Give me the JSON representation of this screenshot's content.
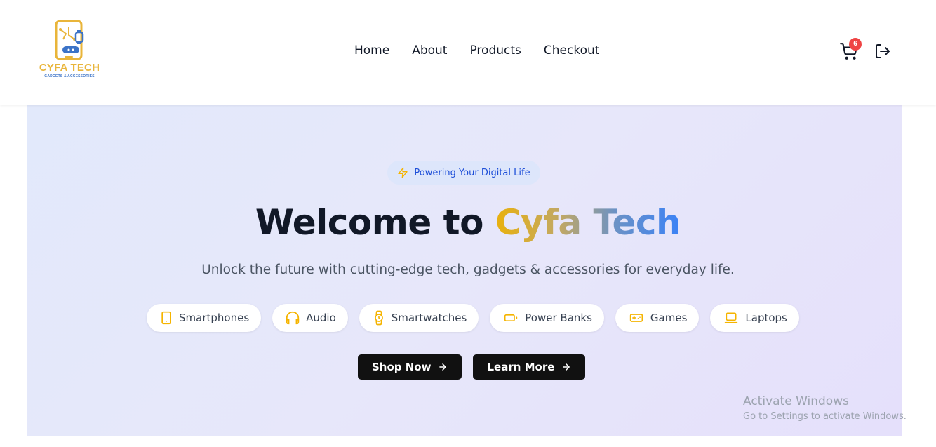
{
  "brand": {
    "name": "CYFA TECH",
    "tagline": "GADGETS & ACCESSORIES",
    "primary_color": "#e9b53a",
    "secondary_color": "#3b73c7"
  },
  "nav": {
    "items": [
      {
        "label": "Home"
      },
      {
        "label": "About"
      },
      {
        "label": "Products"
      },
      {
        "label": "Checkout"
      }
    ]
  },
  "header_actions": {
    "cart_icon": "cart-icon",
    "cart_count": "6",
    "logout_icon": "logout-icon"
  },
  "hero": {
    "pill_icon": "lightning-icon",
    "pill_text": "Powering Your Digital Life",
    "title_prefix": "Welcome to ",
    "title_highlight": "Cyfa Tech",
    "subtitle": "Unlock the future with cutting-edge tech, gadgets & accessories for everyday life.",
    "categories": [
      {
        "label": "Smartphones",
        "icon": "smartphone-icon"
      },
      {
        "label": "Audio",
        "icon": "headphones-icon"
      },
      {
        "label": "Smartwatches",
        "icon": "watch-icon"
      },
      {
        "label": "Power Banks",
        "icon": "battery-icon"
      },
      {
        "label": "Games",
        "icon": "gamepad-icon"
      },
      {
        "label": "Laptops",
        "icon": "laptop-icon"
      }
    ],
    "buttons": [
      {
        "label": "Shop Now",
        "icon": "arrow-right-icon"
      },
      {
        "label": "Learn More",
        "icon": "arrow-right-icon"
      }
    ],
    "accent_color": "#f5b400"
  },
  "watermark": {
    "line1": "Activate Windows",
    "line2": "Go to Settings to activate Windows."
  }
}
